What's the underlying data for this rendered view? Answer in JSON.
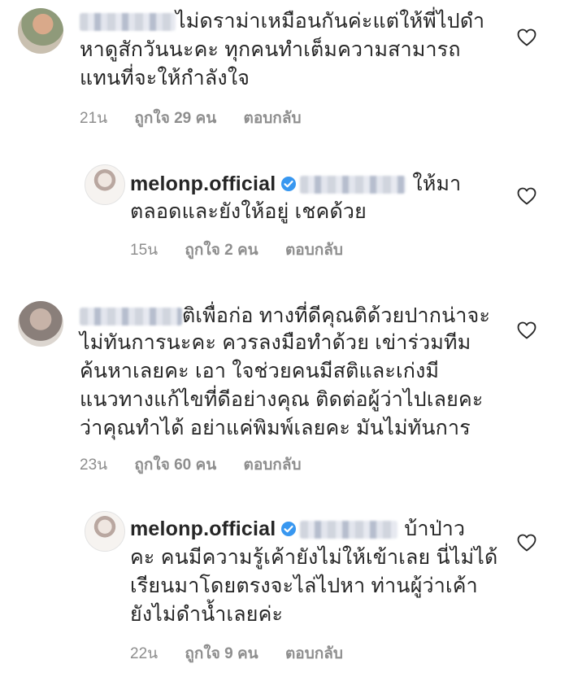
{
  "comments": [
    {
      "lines": [
        "ไม่ดราม่าเหมือนกันค่ะแต่ให้พี่ไปดำ",
        "หาดูสักวันนะคะ ทุกคนทำเต็มความสามารถ",
        "แทนที่จะให้กำลังใจ"
      ],
      "time": "21น",
      "likes": "ถูกใจ 29 คน",
      "reply": "ตอบกลับ"
    },
    {
      "username": "melonp.official",
      "lines": [
        "ให้มา",
        "ตลอดและยังให้อยู่ เชคด้วย"
      ],
      "time": "15น",
      "likes": "ถูกใจ 2 คน",
      "reply": "ตอบกลับ"
    },
    {
      "lines": [
        "ติเพื่อก่อ ทางที่ดีคุณติด้วยปากน่าจะ",
        "ไม่ทันการนะคะ ควรลงมือทำด้วย เข่าร่วมทีม",
        "ค้นหาเลยคะ เอา ใจช่วยคนมีสติและเก่งมี",
        "แนวทางแก้ไขที่ดีอย่างคุณ ติดต่อผู้ว่าไปเลยคะ",
        "ว่าคุณทำได้ อย่าแค่พิมพ์เลยคะ มันไม่ทันการ"
      ],
      "time": "23น",
      "likes": "ถูกใจ 60 คน",
      "reply": "ตอบกลับ"
    },
    {
      "username": "melonp.official",
      "lines": [
        "บ้าป่าว",
        "คะ คนมีความรู้เค้ายังไม่ให้เข้าเลย นี่ไม่ได้",
        "เรียนมาโดยตรงจะไล่ไปหา ท่านผู้ว่าเค้า",
        "ยังไม่ดำน้ำเลยค่ะ"
      ],
      "time": "22น",
      "likes": "ถูกใจ 9 คน",
      "reply": "ตอบกลับ"
    }
  ],
  "icons": {
    "like": "heart-outline-icon",
    "verified": "verified-badge-icon"
  },
  "colors": {
    "text": "#262626",
    "meta": "#8e8e8e",
    "verified": "#3897f0"
  }
}
